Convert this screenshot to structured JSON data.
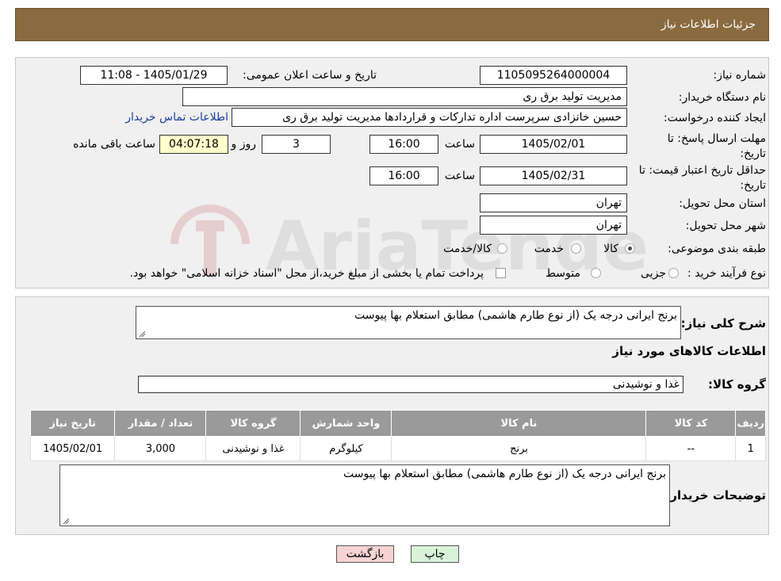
{
  "header": {
    "title": "جزئیات اطلاعات نیاز"
  },
  "labels": {
    "need_number": "شماره نیاز:",
    "announce_datetime": "تاریخ و ساعت اعلان عمومی:",
    "buyer_org": "نام دستگاه خریدار:",
    "requester": "ایجاد کننده درخواست:",
    "contact_link": "اطلاعات تماس خریدار",
    "reply_deadline": "مهلت ارسال پاسخ: تا تاریخ:",
    "hour": "ساعت",
    "day_and": "روز و",
    "remaining": "ساعت باقی مانده",
    "price_validity": "حداقل تاریخ اعتبار قیمت: تا تاریخ:",
    "province": "استان محل تحویل:",
    "city": "شهر محل تحویل:",
    "category": "طبقه بندی موضوعی:",
    "purchase_type": "نوع فرآیند خرید :",
    "need_desc": "شرح کلی نیاز:",
    "goods_info": "اطلاعات کالاهای مورد نیاز",
    "goods_group": "گروه کالا:",
    "buyer_notes": "توضیحات خریدار:"
  },
  "fields": {
    "need_number": "1105095264000004",
    "announce_datetime": "1405/01/29 - 11:08",
    "buyer_org": "مدیریت تولید برق ری",
    "requester": "حسین خانزادی سرپرست اداره تدارکات و قراردادها مدیریت تولید برق ری",
    "reply_date": "1405/02/01",
    "reply_time": "16:00",
    "days": "3",
    "remaining_time": "04:07:18",
    "validity_date": "1405/02/31",
    "validity_time": "16:00",
    "province": "تهران",
    "city": "تهران",
    "need_desc": "برنج ایرانی درجه یک (از نوع طارم هاشمی)  مطابق استعلام بها پیوست",
    "goods_group": "غذا و نوشیدنی",
    "buyer_notes": "برنج ایرانی درجه یک (از نوع طارم هاشمی)  مطابق استعلام بها پیوست"
  },
  "category_options": [
    "کالا",
    "خدمت",
    "کالا/خدمت"
  ],
  "category_selected": "کالا",
  "purchase_options": [
    "جزیی",
    "متوسط"
  ],
  "purchase_note": "پرداخت تمام یا بخشی از مبلغ خرید،از محل \"اسناد خزانه اسلامی\" خواهد بود.",
  "table": {
    "headers": [
      "ردیف",
      "کد کالا",
      "نام کالا",
      "واحد شمارش",
      "گروه کالا",
      "تعداد / مقدار",
      "تاریخ نیاز"
    ],
    "rows": [
      [
        "1",
        "--",
        "برنج",
        "کیلوگرم",
        "غذا و نوشیدنی",
        "3,000",
        "1405/02/01"
      ]
    ]
  },
  "buttons": {
    "print": "چاپ",
    "back": "بازگشت"
  },
  "watermark": "AriaTender.neT",
  "colors": {
    "header_bg": "#8a6a3f",
    "back_button_bg": "#f6d3d3",
    "print_button_bg": "#d9f3d9",
    "link": "#1a3f9a"
  }
}
